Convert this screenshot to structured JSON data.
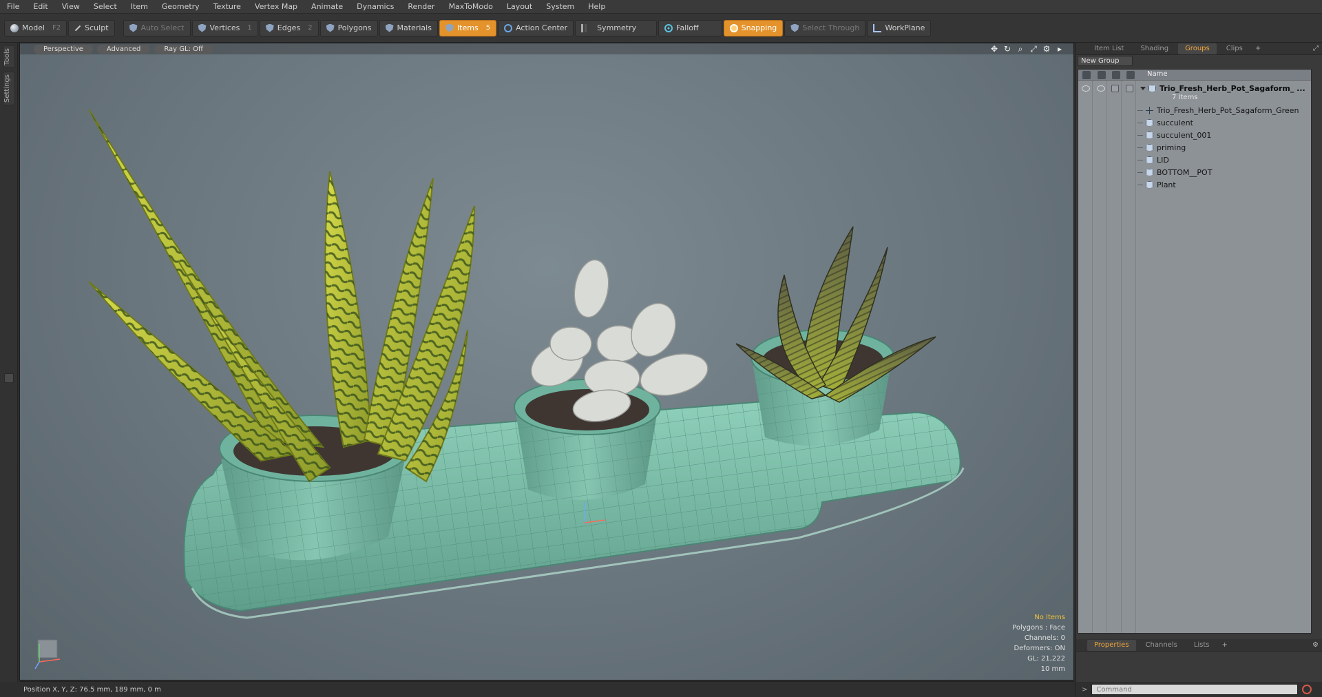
{
  "menu": [
    "File",
    "Edit",
    "View",
    "Select",
    "Item",
    "Geometry",
    "Texture",
    "Vertex Map",
    "Animate",
    "Dynamics",
    "Render",
    "MaxToModo",
    "Layout",
    "System",
    "Help"
  ],
  "toolbar": {
    "model": {
      "label": "Model",
      "key": "F2"
    },
    "sculpt": {
      "label": "Sculpt"
    },
    "auto_select": {
      "label": "Auto Select"
    },
    "vertices": {
      "label": "Vertices",
      "key": "1"
    },
    "edges": {
      "label": "Edges",
      "key": "2"
    },
    "polygons": {
      "label": "Polygons"
    },
    "materials": {
      "label": "Materials"
    },
    "items": {
      "label": "Items",
      "key": "5"
    },
    "action_center": {
      "label": "Action Center"
    },
    "symmetry": {
      "label": "Symmetry"
    },
    "falloff": {
      "label": "Falloff"
    },
    "snapping": {
      "label": "Snapping"
    },
    "select_through": {
      "label": "Select Through"
    },
    "workplane": {
      "label": "WorkPlane"
    }
  },
  "left_tabs": [
    "Tools",
    "Settings"
  ],
  "viewport": {
    "view": "Perspective",
    "style": "Advanced",
    "raygl": "Ray GL: Off",
    "info": {
      "selection": "No Items",
      "polygons": "Polygons : Face",
      "channels": "Channels: 0",
      "deformers": "Deformers: ON",
      "gl": "GL: 21,222",
      "scale": "10 mm"
    }
  },
  "status": {
    "position": "Position X, Y, Z:   76.5 mm, 189 mm, 0 m"
  },
  "right_panel": {
    "tabs": [
      "Item List",
      "Shading",
      "Groups",
      "Clips"
    ],
    "active_tab": "Groups",
    "new_group": "New Group",
    "column_name": "Name",
    "root": {
      "name": "Trio_Fresh_Herb_Pot_Sagaform_ ...",
      "count": "7 Items"
    },
    "children": [
      "Trio_Fresh_Herb_Pot_Sagaform_Green",
      "succulent",
      "succulent_001",
      "priming",
      "LID",
      "BOTTOM__POT",
      "Plant"
    ],
    "bottom_tabs": [
      "Properties",
      "Channels",
      "Lists"
    ],
    "command_placeholder": "Command"
  },
  "colors": {
    "accent": "#e4932c",
    "tab_active": "#f0a63a",
    "warn": "#f0c23a",
    "pot": "#78b8a4",
    "soil": "#3f3632",
    "plant_left": "#b7c24a",
    "succulent": "#d9dbd6",
    "plant_right": "#6c6e4a"
  },
  "icons": {
    "model": "sphere-icon",
    "sculpt": "brush-icon",
    "mesh": "mesh-icon",
    "locator": "locator-icon",
    "eye": "eye-icon",
    "render": "render-icon",
    "lock": "lock-icon",
    "info": "info-icon"
  }
}
